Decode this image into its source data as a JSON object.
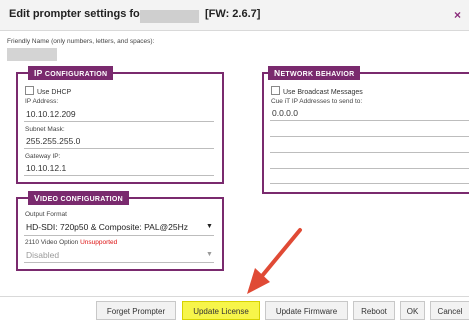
{
  "dialog": {
    "title_prefix": "Edit prompter settings for",
    "firmware": "[FW: 2.6.7]",
    "close_glyph": "×",
    "friendly_name_label": "Friendly Name (only numbers, letters, and spaces):"
  },
  "ip_config": {
    "legend_first": "IP",
    "legend_rest": "CONFIGURATION",
    "dhcp_label": "Use DHCP",
    "dhcp_checked": false,
    "ip_label": "IP Address:",
    "ip_value": "10.10.12.209",
    "mask_label": "Subnet Mask:",
    "mask_value": "255.255.255.0",
    "gateway_label": "Gateway IP:",
    "gateway_value": "10.10.12.1"
  },
  "network": {
    "legend_first": "N",
    "legend_rest": "ETWORK BEHAVIOR",
    "broadcast_label": "Use Broadcast Messages",
    "broadcast_checked": false,
    "cue_label": "Cue iT IP Addresses to send to:",
    "cue_values": [
      "0.0.0.0",
      "",
      "",
      "",
      ""
    ]
  },
  "video": {
    "legend_first": "V",
    "legend_rest": "IDEO CONFIGURATION",
    "output_label": "Output Format",
    "output_value": "HD-SDI: 720p50 & Composite: PAL@25Hz",
    "option_label": "2110 Video Option",
    "option_status": "Unsupported",
    "option_value": "Disabled"
  },
  "buttons": {
    "forget": "Forget Prompter",
    "update_license": "Update License",
    "update_firmware": "Update Firmware",
    "reboot": "Reboot",
    "ok": "OK",
    "cancel": "Cancel"
  },
  "annotation": {
    "arrow_color": "#e04a35",
    "arrow_target": "update_license"
  },
  "colors": {
    "accent": "#7a2a6e",
    "highlight": "#f7f54a"
  }
}
